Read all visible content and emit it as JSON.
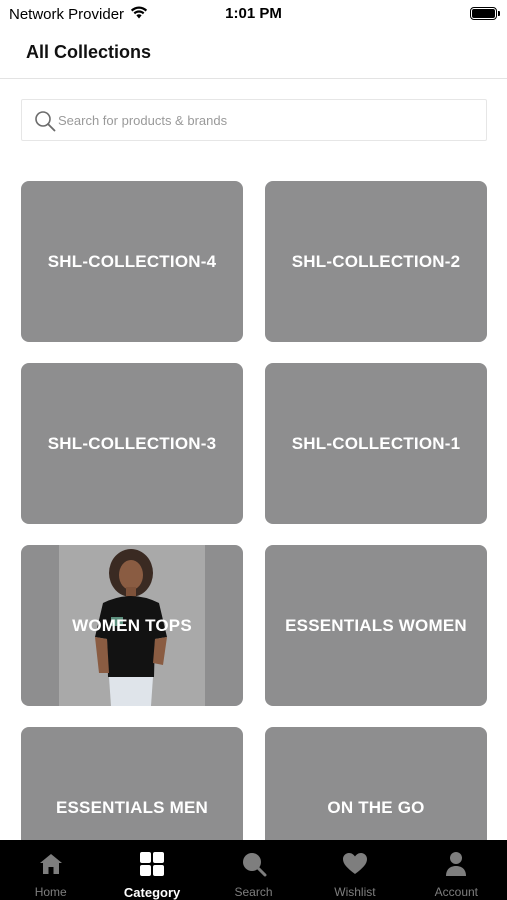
{
  "status_bar": {
    "carrier": "Network Provider",
    "time": "1:01 PM"
  },
  "header": {
    "title": "All Collections"
  },
  "search": {
    "placeholder": "Search for products & brands",
    "value": ""
  },
  "collections": [
    {
      "label": "SHL-COLLECTION-4"
    },
    {
      "label": "SHL-COLLECTION-2"
    },
    {
      "label": "SHL-COLLECTION-3"
    },
    {
      "label": "SHL-COLLECTION-1"
    },
    {
      "label": "WOMEN TOPS"
    },
    {
      "label": "ESSENTIALS WOMEN"
    },
    {
      "label": "ESSENTIALS MEN"
    },
    {
      "label": "ON THE GO"
    }
  ],
  "tab_bar": {
    "tabs": [
      {
        "label": "Home",
        "icon": "home-icon"
      },
      {
        "label": "Category",
        "icon": "category-grid-icon",
        "active": true
      },
      {
        "label": "Search",
        "icon": "search-icon"
      },
      {
        "label": "Wishlist",
        "icon": "heart-icon"
      },
      {
        "label": "Account",
        "icon": "user-icon"
      }
    ]
  },
  "colors": {
    "tile_background": "#8e8e8f",
    "tab_bar_background": "#000000",
    "tab_active": "#ffffff",
    "tab_inactive": "#7e7e7e"
  }
}
